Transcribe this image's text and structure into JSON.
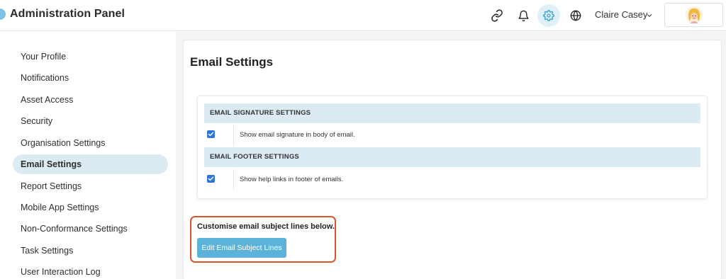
{
  "header": {
    "app_title": "Administration Panel",
    "user_name": "Claire Casey",
    "icons": [
      "link-icon",
      "bell-icon",
      "gear-icon",
      "globe-icon",
      "chevron-down-icon"
    ]
  },
  "sidebar": {
    "items": [
      {
        "label": "Your Profile"
      },
      {
        "label": "Notifications"
      },
      {
        "label": "Asset Access"
      },
      {
        "label": "Security"
      },
      {
        "label": "Organisation Settings"
      },
      {
        "label": "Email Settings",
        "active": true
      },
      {
        "label": "Report Settings"
      },
      {
        "label": "Mobile App Settings"
      },
      {
        "label": "Non-Conformance Settings"
      },
      {
        "label": "Task Settings"
      },
      {
        "label": "User Interaction Log"
      }
    ]
  },
  "main": {
    "title": "Email Settings",
    "sections": [
      {
        "heading": "EMAIL SIGNATURE SETTINGS",
        "option": "Show email signature in body of email.",
        "checked": true
      },
      {
        "heading": "EMAIL FOOTER SETTINGS",
        "option": "Show help links in footer of emails.",
        "checked": true
      }
    ],
    "subject": {
      "label": "Customise email subject lines below.",
      "button": "Edit Email Subject Lines"
    }
  },
  "colors": {
    "accent": "#5bb3d9",
    "active_nav": "#dcebf3",
    "section_header": "#dbeaf3",
    "checkbox": "#2f74de",
    "highlight_border": "#d9542c"
  }
}
